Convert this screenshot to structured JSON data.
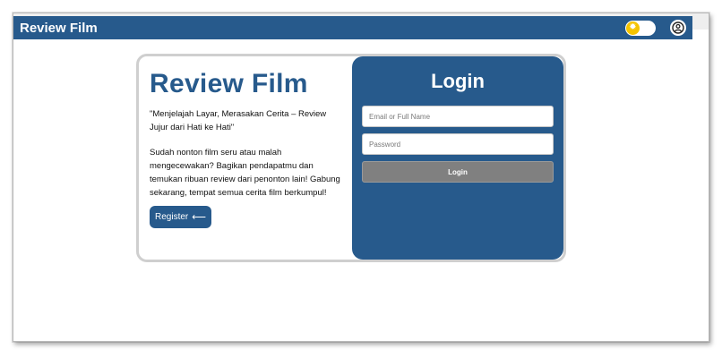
{
  "navbar": {
    "brand": "Review Film",
    "theme_toggle_icon": "sun-icon",
    "user_icon": "user-icon"
  },
  "hero": {
    "title": "Review Film",
    "tagline": "\"Menjelajah Layar, Merasakan Cerita – Review Jujur dari Hati ke Hati\"",
    "description": "Sudah nonton film seru atau malah mengecewakan? Bagikan pendapatmu dan temukan ribuan review dari penonton lain! Gabung sekarang, tempat semua cerita film berkumpul!",
    "register_label": "Register",
    "register_icon": "arrow-left-icon"
  },
  "login": {
    "title": "Login",
    "email_placeholder": "Email or Full Name",
    "password_placeholder": "Password",
    "button_label": "Login"
  },
  "colors": {
    "primary": "#275a8c",
    "toggle_knob": "#f5c400",
    "login_button": "#808080"
  }
}
